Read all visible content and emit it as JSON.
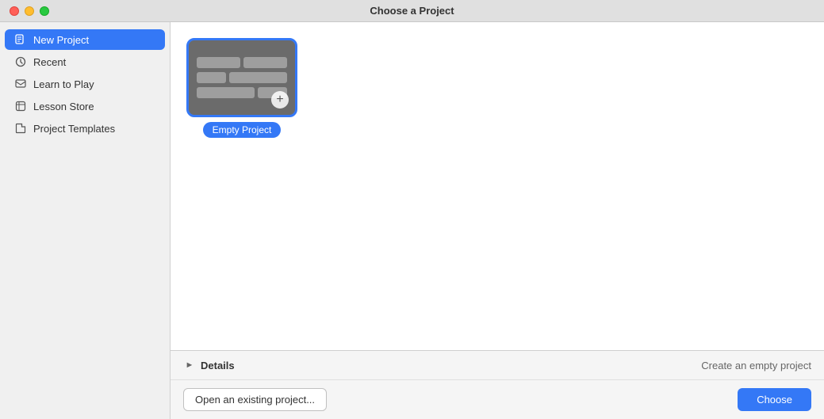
{
  "titlebar": {
    "title": "Choose a Project"
  },
  "sidebar": {
    "items": [
      {
        "id": "new-project",
        "label": "New Project",
        "icon": "📄",
        "active": true
      },
      {
        "id": "recent",
        "label": "Recent",
        "icon": "🕐",
        "active": false
      },
      {
        "id": "learn-to-play",
        "label": "Learn to Play",
        "icon": "🎓",
        "active": false
      },
      {
        "id": "lesson-store",
        "label": "Lesson Store",
        "icon": "⭐",
        "active": false
      },
      {
        "id": "project-templates",
        "label": "Project Templates",
        "icon": "📁",
        "active": false
      }
    ]
  },
  "content": {
    "project_card": {
      "label": "Empty Project"
    }
  },
  "bottom_bar": {
    "details_label": "Details",
    "details_description": "Create an empty project",
    "open_existing_label": "Open an existing project...",
    "choose_label": "Choose"
  }
}
